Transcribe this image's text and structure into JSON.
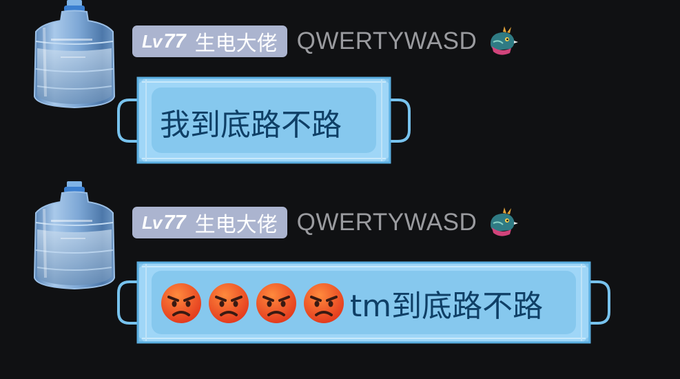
{
  "messages": [
    {
      "avatar": "water-jug-avatar",
      "level_prefix": "Lv",
      "level_number": "77",
      "title": "生电大佬",
      "username": "QWERTYWASD",
      "badge_icon": "dragon-icon",
      "text": "我到底路不路",
      "emojis": []
    },
    {
      "avatar": "water-jug-avatar",
      "level_prefix": "Lv",
      "level_number": "77",
      "title": "生电大佬",
      "username": "QWERTYWASD",
      "badge_icon": "dragon-icon",
      "text": "tm到底路不路",
      "emojis": [
        "angry-face-icon",
        "angry-face-icon",
        "angry-face-icon",
        "angry-face-icon"
      ]
    }
  ],
  "colors": {
    "background": "#101113",
    "level_badge": "#abb4cf",
    "username": "#9a9b9f",
    "mask_fill": "#8fcdf0",
    "mask_text": "#0f3f66"
  }
}
